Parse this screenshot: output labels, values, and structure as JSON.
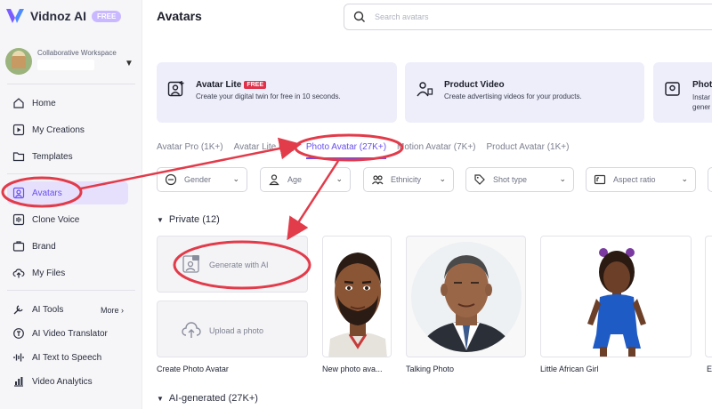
{
  "app": {
    "logo_text": "Vidnoz AI",
    "badge": "FREE"
  },
  "workspace": {
    "label": "Collaborative Workspace"
  },
  "sidebar": {
    "items": [
      {
        "label": "Home",
        "icon": "home-icon"
      },
      {
        "label": "My Creations",
        "icon": "play-square-icon"
      },
      {
        "label": "Templates",
        "icon": "folder-icon"
      },
      {
        "label": "Avatars",
        "icon": "avatar-icon",
        "active": true
      },
      {
        "label": "Clone Voice",
        "icon": "voice-icon"
      },
      {
        "label": "Brand",
        "icon": "briefcase-icon"
      },
      {
        "label": "My Files",
        "icon": "upload-cloud-icon"
      },
      {
        "label": "AI Tools",
        "icon": "tools-icon"
      },
      {
        "label": "AI Video Translator",
        "icon": "translate-icon"
      },
      {
        "label": "AI Text to Speech",
        "icon": "waveform-icon"
      },
      {
        "label": "Video Analytics",
        "icon": "chart-icon"
      }
    ],
    "more_label": "More"
  },
  "header": {
    "title": "Avatars",
    "search_placeholder": "Search avatars"
  },
  "promos": [
    {
      "title": "Avatar Lite",
      "tag": "FREE",
      "subtitle": "Create your digital twin for free in 10 seconds."
    },
    {
      "title": "Product Video",
      "subtitle": "Create advertising videos for your products."
    },
    {
      "title": "Photo",
      "subtitle": "Instan gener"
    }
  ],
  "tabs": [
    {
      "label": "Avatar Pro (1K+)"
    },
    {
      "label": "Avatar Lite (1K)"
    },
    {
      "label": "Photo Avatar (27K+)",
      "active": true
    },
    {
      "label": "Motion Avatar (7K+)"
    },
    {
      "label": "Product Avatar (1K+)"
    }
  ],
  "filters": [
    {
      "label": "Gender"
    },
    {
      "label": "Age"
    },
    {
      "label": "Ethnicity"
    },
    {
      "label": "Shot type"
    },
    {
      "label": "Aspect ratio"
    }
  ],
  "private": {
    "label": "Private (12)"
  },
  "actions": {
    "generate": "Generate with AI",
    "upload": "Upload a photo",
    "create_label": "Create Photo Avatar"
  },
  "cards": [
    {
      "label": "New photo ava..."
    },
    {
      "label": "Talking Photo"
    },
    {
      "label": "Little African Girl"
    }
  ],
  "ai_generated": {
    "label": "AI-generated (27K+)"
  },
  "colors": {
    "accent": "#6a4ff0",
    "annotation": "#e23b4a",
    "promo_bg": "#eeeefb"
  }
}
